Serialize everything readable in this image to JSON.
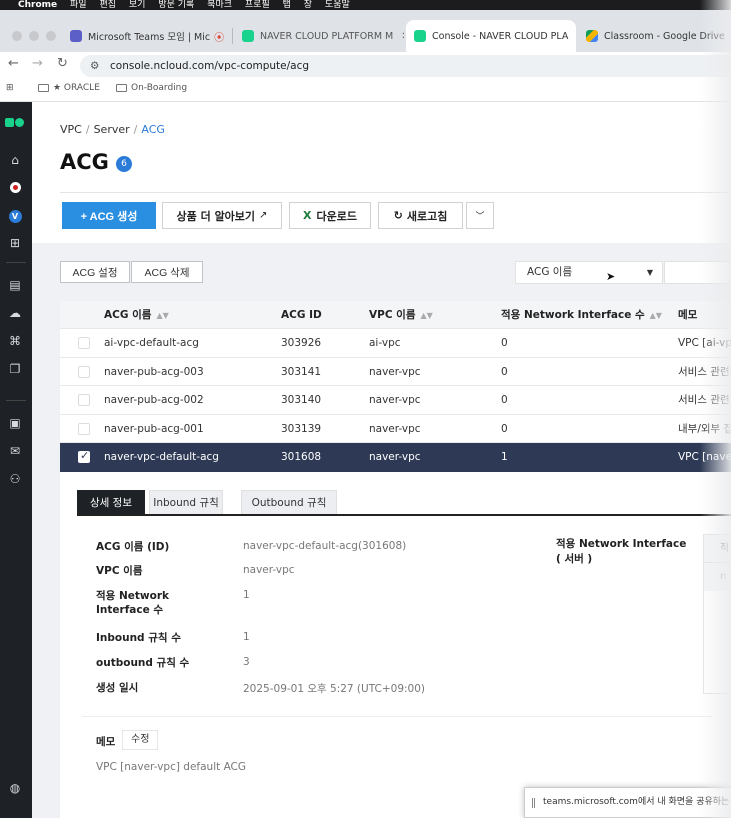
{
  "mac_menu": {
    "app": "Chrome",
    "items": [
      "파일",
      "편집",
      "보기",
      "방문 기록",
      "북마크",
      "프로필",
      "탭",
      "창",
      "도움말"
    ]
  },
  "tabs": [
    {
      "label": "Microsoft Teams 모임 | Mic",
      "favicon_color": "#5b5fc7",
      "close": "✕"
    },
    {
      "label": "NAVER CLOUD PLATFORM M",
      "favicon_color": "#19d28b",
      "close": "✕"
    },
    {
      "label": "Console - NAVER CLOUD PLA",
      "favicon_color": "#19d28b",
      "close": "✕"
    },
    {
      "label": "Classroom - Google Drive",
      "favicon_color": "#f4b400",
      "close": ""
    }
  ],
  "address": {
    "url": "console.ncloud.com/vpc-compute/acg"
  },
  "bookmarks": [
    {
      "label": ""
    },
    {
      "label": "★ ORACLE"
    },
    {
      "label": "On-Boarding"
    }
  ],
  "breadcrumb": {
    "item1": "VPC",
    "sep1": "/",
    "item2": "Server",
    "sep2": "/",
    "current": "ACG"
  },
  "page": {
    "title": "ACG",
    "count": "6"
  },
  "toolbar": {
    "create": "+ ACG 생성",
    "learn_more": "상품 더 알아보기",
    "download": "다운로드",
    "refresh": "새로고침"
  },
  "actions": {
    "settings": "ACG 설정",
    "delete": "ACG 삭제"
  },
  "filter": {
    "selected": "ACG 이름"
  },
  "table": {
    "headers": [
      "ACG 이름",
      "ACG ID",
      "VPC 이름",
      "적용 Network Interface 수",
      "메모"
    ],
    "rows": [
      [
        "ai-vpc-default-acg",
        "303926",
        "ai-vpc",
        "0",
        "VPC [ai-vpc"
      ],
      [
        "naver-pub-acg-003",
        "303141",
        "naver-vpc",
        "0",
        "서비스 관련"
      ],
      [
        "naver-pub-acg-002",
        "303140",
        "naver-vpc",
        "0",
        "서비스 관련"
      ],
      [
        "naver-pub-acg-001",
        "303139",
        "naver-vpc",
        "0",
        "내부/외부 접"
      ],
      [
        "naver-vpc-default-acg",
        "301608",
        "naver-vpc",
        "1",
        "VPC [naver"
      ]
    ],
    "selected_index": 4
  },
  "detail": {
    "tabs": [
      "상세 정보",
      "Inbound 규칙",
      "Outbound 규칙"
    ],
    "fields": [
      {
        "label": "ACG 이름 (ID)",
        "value": "naver-vpc-default-acg(301608)"
      },
      {
        "label": "VPC 이름",
        "value": "naver-vpc"
      },
      {
        "label": "적용 Network Interface 수",
        "value": "1"
      },
      {
        "label": "Inbound 규칙 수",
        "value": "1"
      },
      {
        "label": "outbound 규칙 수",
        "value": "3"
      },
      {
        "label": "생성 일시",
        "value": "2025-09-01 오후 5:27 (UTC+09:00)"
      }
    ],
    "interface_label": "적용 Network Interface\n( 서버 )",
    "interface_table_head": "적",
    "interface_table_row": "n",
    "memo_label": "메모",
    "memo_edit": "수정",
    "memo_text": "VPC [naver-vpc] default ACG"
  },
  "share_notice": "teams.microsoft.com에서 내 화면을 공유하는 중입니다."
}
